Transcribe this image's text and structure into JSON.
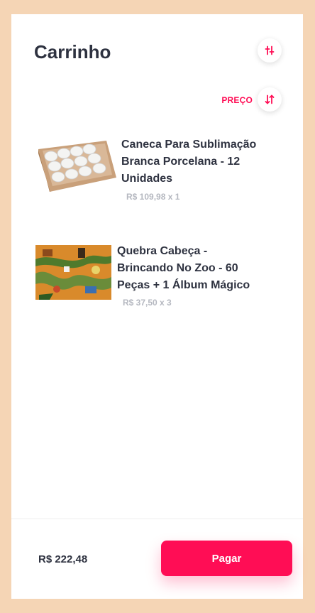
{
  "header": {
    "title": "Carrinho"
  },
  "sort": {
    "label": "PREÇO"
  },
  "items": [
    {
      "name": "Caneca Para Sublimação Branca Porcelana - 12 Unidades",
      "price": "R$ 109,98 x 1"
    },
    {
      "name": "Quebra Cabeça - Brincando No Zoo - 60 Peças + 1 Álbum Mágico",
      "price": "R$ 37,50 x 3"
    }
  ],
  "footer": {
    "total": "R$ 222,48",
    "pay_label": "Pagar"
  },
  "colors": {
    "accent": "#ff0d55",
    "background": "#f5d5b5",
    "text": "#2e3240",
    "muted": "#b5b8c0"
  },
  "icons": {
    "filter": "filter-sliders-icon",
    "sort": "sort-arrows-icon"
  }
}
